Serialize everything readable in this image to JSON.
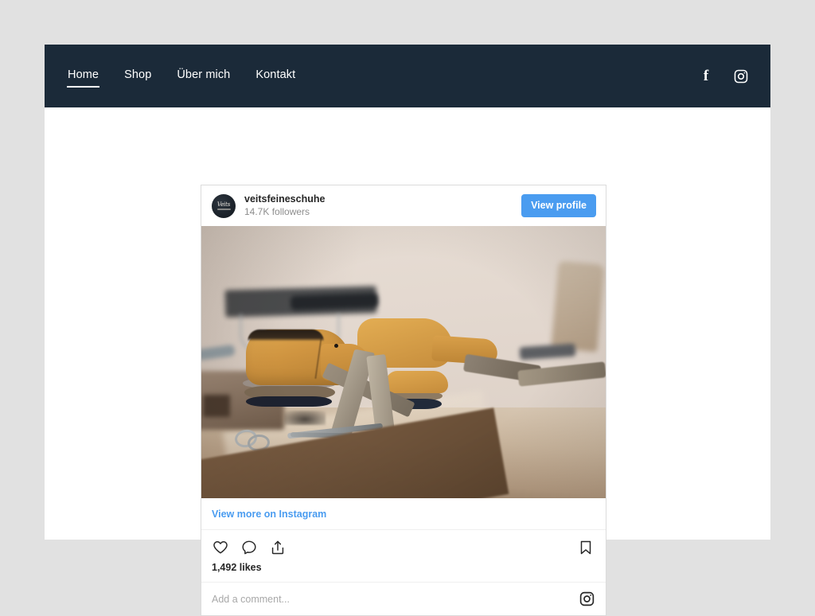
{
  "site": {
    "nav": {
      "items": [
        {
          "label": "Home",
          "active": true
        },
        {
          "label": "Shop",
          "active": false
        },
        {
          "label": "Über mich",
          "active": false
        },
        {
          "label": "Kontakt",
          "active": false
        }
      ],
      "social": [
        {
          "name": "facebook-icon",
          "glyph": "f"
        },
        {
          "name": "instagram-icon",
          "glyph": ""
        }
      ],
      "background_color": "#1b2a39",
      "text_color": "#ffffff"
    },
    "page_background_color": "#e1e1e1",
    "content_background_color": "#ffffff"
  },
  "instagram_embed": {
    "account": {
      "username": "veitsfeineschuhe",
      "followers": "14.7K followers",
      "avatar_mark": "Veits",
      "avatar_background": "#1d242c"
    },
    "view_profile_label": "View profile",
    "accent_color": "#4a9cf0",
    "photo": {
      "alt": "Yellow wooden shoe lasts with cork soles, leather strips and scissors on a cobbler's workbench",
      "palette": {
        "wall": "#e3d8cf",
        "last_yellow": "#cf9440",
        "table": "#cbb79f",
        "table_edge": "#6b4e38",
        "leather": "#8d8273",
        "sole_dark": "#1d2230"
      }
    },
    "view_more_label": "View more on Instagram",
    "actions": [
      {
        "name": "like-icon",
        "label": "Like"
      },
      {
        "name": "comment-icon",
        "label": "Comment"
      },
      {
        "name": "share-icon",
        "label": "Share"
      }
    ],
    "save_action": {
      "name": "bookmark-icon",
      "label": "Save"
    },
    "likes": "1,492 likes",
    "comment_placeholder": "Add a comment...",
    "comment_value": ""
  }
}
